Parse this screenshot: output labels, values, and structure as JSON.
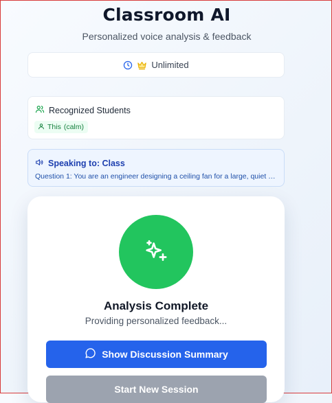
{
  "header": {
    "title": "Classroom AI",
    "subtitle": "Personalized voice analysis & feedback"
  },
  "usage": {
    "label": "Unlimited",
    "icons": [
      "clock-icon",
      "crown-icon"
    ]
  },
  "students": {
    "heading": "Recognized Students",
    "items": [
      {
        "name": "This",
        "mood": "(calm)"
      }
    ]
  },
  "speaking": {
    "heading": "Speaking to: Class",
    "question": "Question 1: You are an engineer designing a ceiling fan for a large, quiet libra..."
  },
  "status": {
    "title": "Analysis Complete",
    "subtitle": "Providing personalized feedback..."
  },
  "actions": {
    "summary_label": "Show Discussion Summary",
    "new_session_label": "Start New Session"
  },
  "colors": {
    "accent": "#2563eb",
    "success": "#22c55e",
    "disabled": "#9ca3af",
    "speaking_text": "#1e40af"
  }
}
